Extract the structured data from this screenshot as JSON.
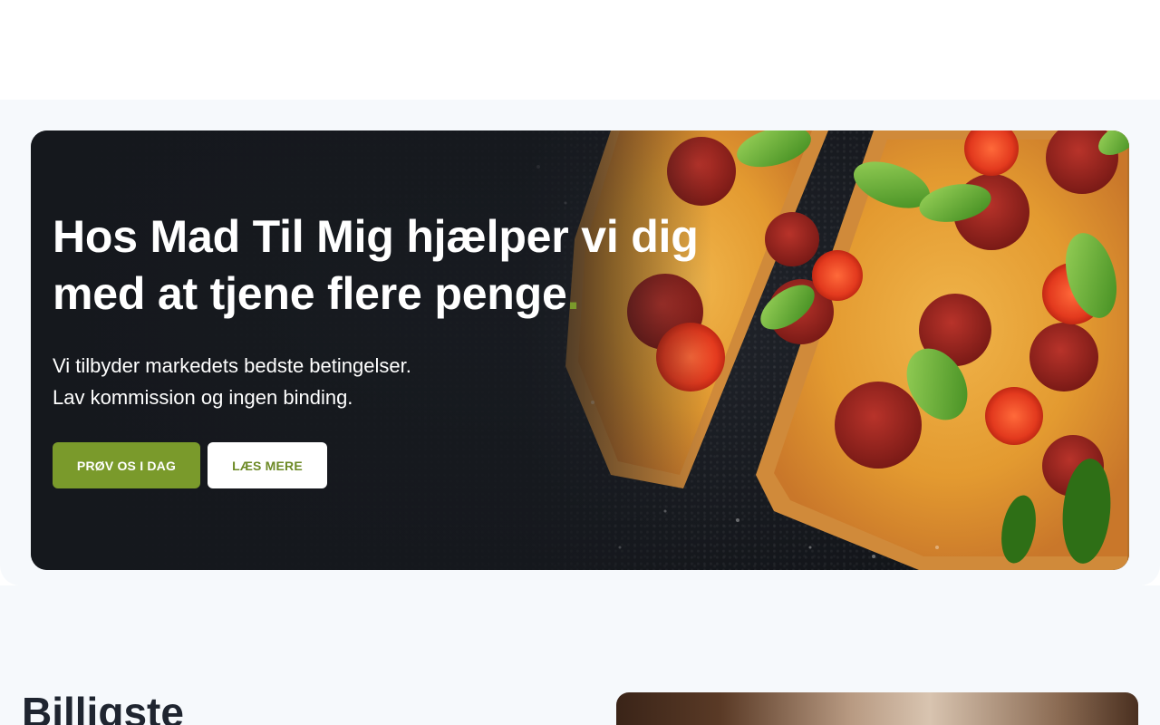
{
  "hero": {
    "title_main": "Hos Mad Til Mig hjælper vi dig med at tjene flere penge",
    "title_dot": ".",
    "subtitle_line1": "Vi tilbyder markedets bedste betingelser.",
    "subtitle_line2": "Lav kommission og ingen binding.",
    "primary_button": "PRØV OS I DAG",
    "secondary_button": "LÆS MERE",
    "background_image": "pizza-image"
  },
  "section2": {
    "heading": "Billigste",
    "image": "restaurant-photo"
  },
  "colors": {
    "accent": "#7a9a2b",
    "page_background": "#f6f9fc",
    "hero_background": "#1b1e24",
    "heading_text": "#1f2530"
  }
}
